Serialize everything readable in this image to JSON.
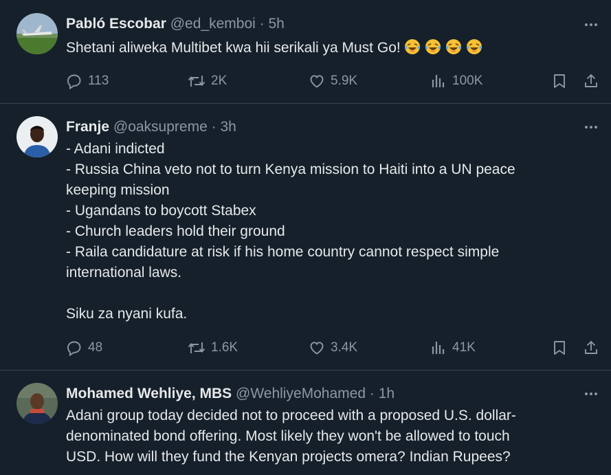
{
  "tweets": [
    {
      "name": "Pabló Escobar",
      "handle": "@ed_kemboi",
      "dot": "·",
      "time": "5h",
      "text": "Shetani aliweka Multibet kwa hii serikali ya Must Go!",
      "emojis": [
        "face-with-tears-of-joy",
        "face-with-tears-of-joy",
        "face-with-tears-of-joy",
        "face-with-tears-of-joy"
      ],
      "replies": "113",
      "reposts": "2K",
      "likes": "5.9K",
      "views": "100K"
    },
    {
      "name": "Franje",
      "handle": "@oaksupreme",
      "dot": "·",
      "time": "3h",
      "text": "- Adani indicted\n- Russia China veto not to turn Kenya mission to Haiti into a UN peace\nkeeping mission\n- Ugandans to boycott Stabex\n- Church leaders hold their ground\n- Raila candidature at risk if his home country cannot respect simple\ninternational laws.\n\nSiku za nyani kufa.",
      "replies": "48",
      "reposts": "1.6K",
      "likes": "3.4K",
      "views": "41K"
    },
    {
      "name": "Mohamed Wehliye, MBS",
      "handle": "@WehliyeMohamed",
      "dot": "·",
      "time": "1h",
      "text": "Adani group today decided not to proceed with a proposed U.S. dollar-\ndenominated bond offering. Most likely they won't be allowed to touch\nUSD. How will they fund the Kenyan projects omera? Indian Rupees?"
    }
  ],
  "colors": {
    "background": "#15202b",
    "divider": "#38444d",
    "text_primary": "#e7e9ea",
    "text_secondary": "#8b98a5"
  }
}
